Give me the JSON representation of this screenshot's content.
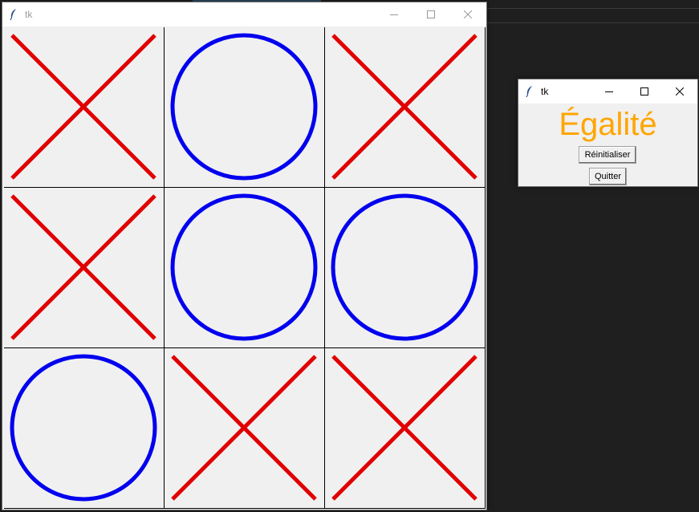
{
  "main_window": {
    "title": "tk",
    "board": [
      [
        "X",
        "O",
        "X"
      ],
      [
        "X",
        "O",
        "O"
      ],
      [
        "O",
        "X",
        "X"
      ]
    ]
  },
  "popup_window": {
    "title": "tk",
    "result_text": "Égalité",
    "reset_label": "Réinitialiser",
    "quit_label": "Quitter"
  },
  "icons": {
    "app": "tk-feather-icon",
    "minimize": "minimize-icon",
    "maximize": "maximize-icon",
    "close": "close-icon"
  },
  "colors": {
    "x_mark": "#e00000",
    "o_mark": "#0000ee",
    "result_text": "#ffa500"
  }
}
